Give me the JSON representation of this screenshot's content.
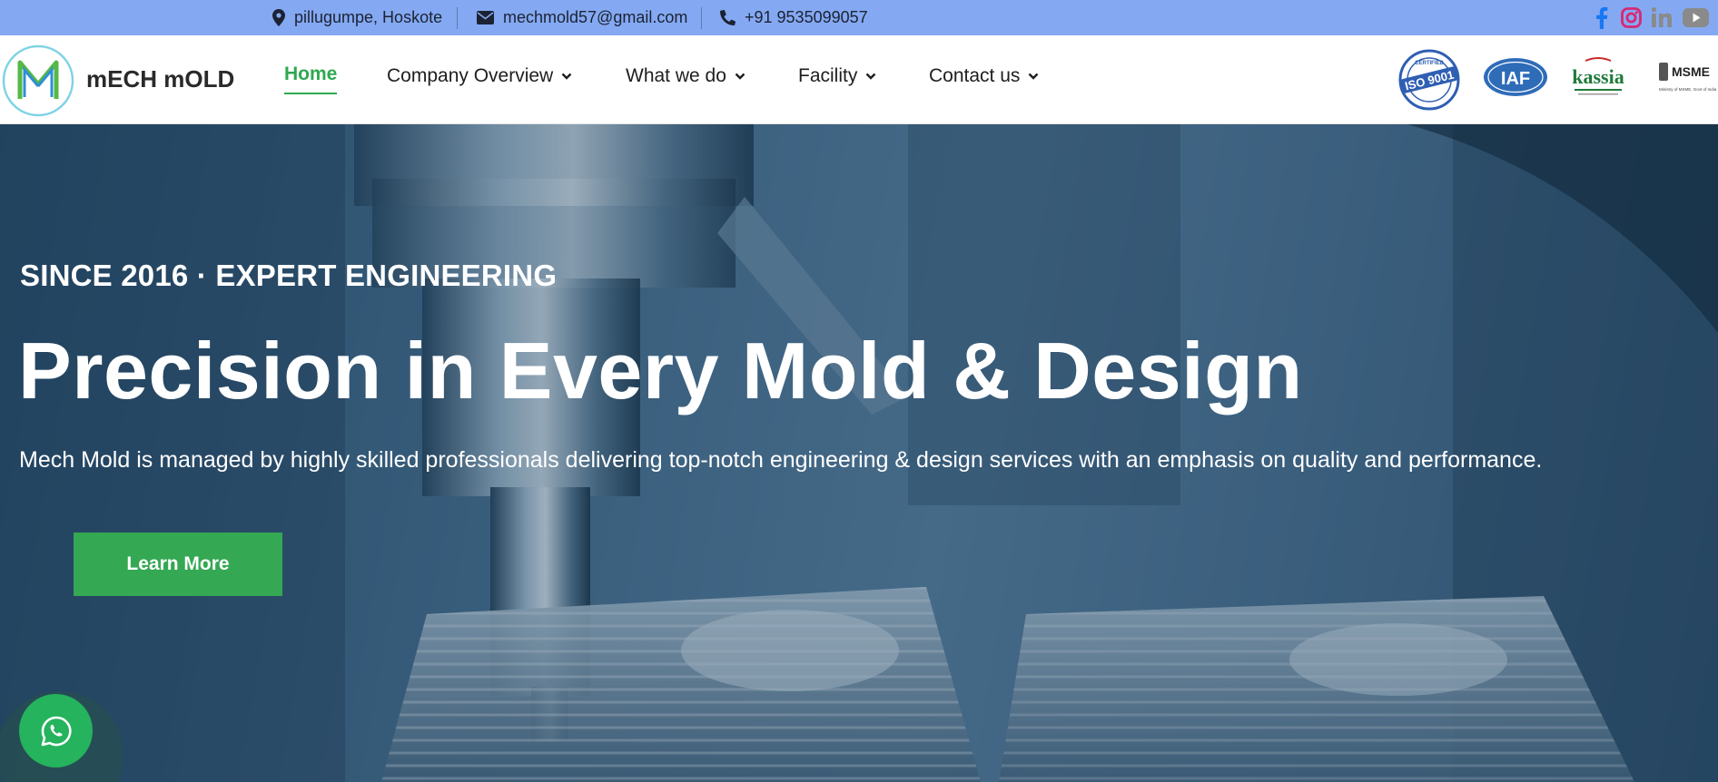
{
  "topbar": {
    "location": "pillugumpe, Hoskote",
    "email": "mechmold57@gmail.com",
    "phone": "+91 9535099057",
    "icons": [
      "map-marker-icon",
      "envelope-icon",
      "phone-icon"
    ],
    "social": [
      "facebook-icon",
      "instagram-icon",
      "linkedin-icon",
      "youtube-icon"
    ]
  },
  "brand": {
    "name": "mECH mOLD"
  },
  "nav": {
    "items": [
      {
        "label": "Home",
        "active": true
      },
      {
        "label": "Company Overview",
        "dropdown": true
      },
      {
        "label": "What we do",
        "dropdown": true
      },
      {
        "label": "Facility",
        "dropdown": true
      },
      {
        "label": "Contact us",
        "dropdown": true
      }
    ]
  },
  "certifications": {
    "iso": "ISO 9001",
    "iso_ring": "CERTIFIED",
    "iaf": "IAF",
    "kassia": "kassia",
    "msme": "MSME",
    "msme_caption": "Ministry of MSME, Govt of India"
  },
  "hero": {
    "eyebrow": "SINCE 2016 · EXPERT ENGINEERING",
    "headline": "Precision in Every Mold & Design",
    "lede": "Mech Mold is managed by highly skilled professionals delivering top-notch engineering & design services with an emphasis on quality and performance.",
    "cta": "Learn More"
  },
  "colors": {
    "topbar_bg": "#84a9f2",
    "accent_green": "#2fa84f",
    "cta_green": "#34a853",
    "whatsapp_green": "#25b35d",
    "facebook": "#1877f2",
    "instagram": "#d62976",
    "linkedin": "#8a8a8a",
    "youtube": "#8a8a8a"
  }
}
